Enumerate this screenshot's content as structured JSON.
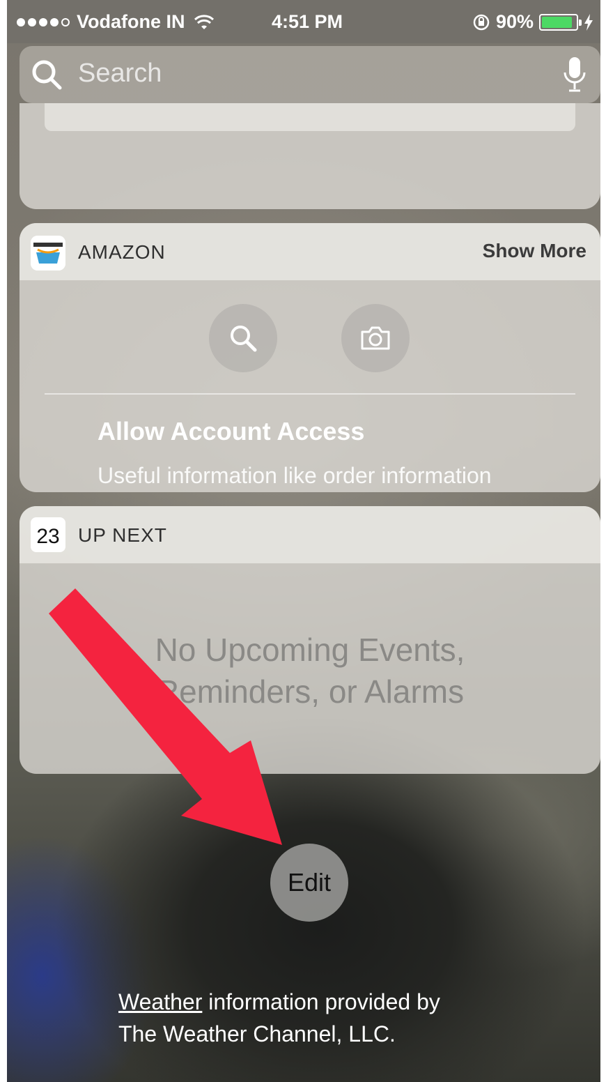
{
  "status_bar": {
    "carrier": "Vodafone IN",
    "time": "4:51 PM",
    "battery": "90%",
    "battery_level": 0.9
  },
  "search": {
    "placeholder": "Search"
  },
  "amazon_widget": {
    "title": "AMAZON",
    "show_more": "Show More",
    "allow_title": "Allow Account Access",
    "allow_subtitle": "Useful information like order information"
  },
  "upnext_widget": {
    "title": "UP NEXT",
    "calendar_day": "23",
    "empty_line1": "No Upcoming Events,",
    "empty_line2": "Reminders, or Alarms"
  },
  "edit_label": "Edit",
  "footer": {
    "link_text": "Weather",
    "line1_rest": " information provided by",
    "line2": "The Weather Channel, LLC."
  },
  "colors": {
    "battery_fill": "#4cd964",
    "annotation_arrow": "#f4233f"
  }
}
